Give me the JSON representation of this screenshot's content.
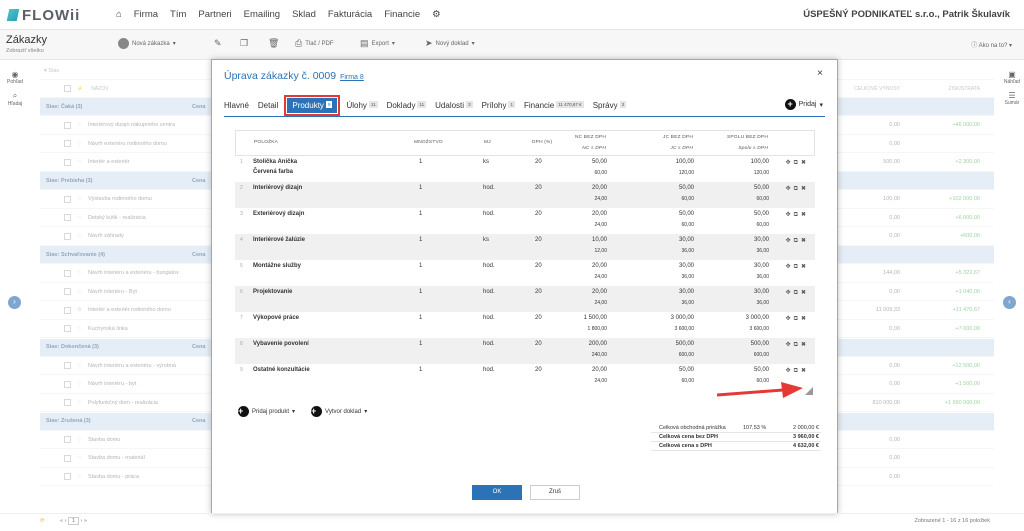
{
  "app": {
    "logo": "FLOWii",
    "menu": [
      "Firma",
      "Tím",
      "Partneri",
      "Emailing",
      "Sklad",
      "Fakturácia",
      "Financie"
    ],
    "company": "ÚSPEŠNÝ PODNIKATEĽ s.r.o., Patrik Škulavík"
  },
  "page": {
    "title": "Zákazky",
    "subtitle": "Zobraziť všetko",
    "toolbar": {
      "new": "Nová zákazka",
      "print": "Tlač / PDF",
      "export": "Export",
      "newdoc": "Nový doklad"
    },
    "help": "Ako na to?",
    "left_side": [
      "Pohľad",
      "Hľadaj"
    ],
    "right_side": [
      "Náhľad",
      "Sumár"
    ],
    "filter": "Stav",
    "col_name": "NÁZOV",
    "col_a": "CELKOVÉ VÝNOSY",
    "col_b": "ZISK/STRATA",
    "footer_left": "1",
    "footer_right": "Zobrazené 1 - 16 z 16 položiek"
  },
  "bg_rows": [
    {
      "g": "Stav: Čaká (3)",
      "c": "Cena"
    },
    {
      "n": "Interiérový dizajn nákupného centra",
      "v1": "0,00",
      "v2": "+46 000,00"
    },
    {
      "n": "Návrh exteriéru rodinného domu",
      "v1": "0,00",
      "v2": ""
    },
    {
      "n": "Interiér a exteriér",
      "v1": "500,00",
      "v2": "+2 300,00"
    },
    {
      "g": "Stav: Prebieha (3)",
      "c": "Cena"
    },
    {
      "n": "Výstavba rodinného domu",
      "v1": "100,00",
      "v2": "+102 000,00"
    },
    {
      "n": "Detský kútik - realizácia",
      "v1": "0,00",
      "v2": "+6 000,00"
    },
    {
      "n": "Návrh záhrady",
      "v1": "0,00",
      "v2": "+600,00"
    },
    {
      "g": "Stav: Schvaľovanie (4)",
      "c": "Cena"
    },
    {
      "n": "Návrh interiéru a exteriéru - bungalov",
      "v1": "144,00",
      "v2": "+5 322,67"
    },
    {
      "n": "Návrh interiéru - Byt",
      "v1": "0,00",
      "v2": "+1 040,00"
    },
    {
      "n": "Interiér a exteriér rodinného domu",
      "v1": "11 009,33",
      "v2": "+11 470,67"
    },
    {
      "n": "Kuchynská linka",
      "v1": "0,00",
      "v2": "+7 000,00"
    },
    {
      "g": "Stav: Dokončená (3)",
      "c": "Cena"
    },
    {
      "n": "Návrh interiéru a exteriéru - výrobná",
      "v1": "0,00",
      "v2": "+12 500,00"
    },
    {
      "n": "Návrh interiéru - byt",
      "v1": "0,00",
      "v2": "+1 500,00"
    },
    {
      "n": "Polyfunkčný dom - realizácia",
      "v1": "810 000,00",
      "v2": "+1 990 000,00"
    },
    {
      "g": "Stav: Zrušená (3)",
      "c": "Cena"
    },
    {
      "n": "Stavba domu",
      "v1": "0,00",
      "v2": ""
    },
    {
      "n": "Stavba domu - materiál",
      "v1": "0,00",
      "v2": ""
    },
    {
      "n": "Stavba domu - práca",
      "v1": "0,00",
      "v2": ""
    }
  ],
  "modal": {
    "title": "Úprava zákazky č. 0009",
    "firm": "Firma 8",
    "close": "×",
    "tabs": [
      {
        "label": "Hlavné"
      },
      {
        "label": "Detail"
      },
      {
        "label": "Produkty",
        "badge": "9",
        "active": true
      },
      {
        "label": "Úlohy",
        "badge": "11"
      },
      {
        "label": "Doklady",
        "badge": "11"
      },
      {
        "label": "Udalosti",
        "badge": "3"
      },
      {
        "label": "Prílohy",
        "badge": "1"
      },
      {
        "label": "Financie",
        "badge": "11 470,67 €"
      },
      {
        "label": "Správy",
        "badge": "3"
      }
    ],
    "add": "Pridaj",
    "headers": {
      "item": "POLOŽKA",
      "qty": "MNOŽSTVO",
      "unit": "MJ",
      "vat": "DPH (%)",
      "nc": "NC BEZ DPH",
      "nc2": "NC s DPH",
      "jc": "JC BEZ DPH",
      "jc2": "JC s DPH",
      "total": "SPOLU BEZ DPH",
      "total2": "Spolu s DPH"
    },
    "items": [
      {
        "n": "1",
        "name": "Stolička Anička",
        "name2": "Červená farba",
        "qty": "1",
        "unit": "ks",
        "vat": "20",
        "a1": "50,00",
        "a2": "60,00",
        "b1": "100,00",
        "b2": "120,00",
        "c1": "100,00",
        "c2": "120,00"
      },
      {
        "n": "2",
        "name": "Interiérový dizajn",
        "qty": "1",
        "unit": "hod.",
        "vat": "20",
        "a1": "20,00",
        "a2": "24,00",
        "b1": "50,00",
        "b2": "60,00",
        "c1": "50,00",
        "c2": "60,00"
      },
      {
        "n": "3",
        "name": "Exteriérový dizajn",
        "qty": "1",
        "unit": "hod.",
        "vat": "20",
        "a1": "20,00",
        "a2": "24,00",
        "b1": "50,00",
        "b2": "60,00",
        "c1": "50,00",
        "c2": "60,00"
      },
      {
        "n": "4",
        "name": "Interiérové žalúzie",
        "qty": "1",
        "unit": "ks",
        "vat": "20",
        "a1": "10,00",
        "a2": "12,00",
        "b1": "30,00",
        "b2": "36,00",
        "c1": "30,00",
        "c2": "36,00"
      },
      {
        "n": "5",
        "name": "Montážne služby",
        "qty": "1",
        "unit": "hod.",
        "vat": "20",
        "a1": "20,00",
        "a2": "24,00",
        "b1": "30,00",
        "b2": "36,00",
        "c1": "30,00",
        "c2": "36,00"
      },
      {
        "n": "6",
        "name": "Projektovanie",
        "qty": "1",
        "unit": "hod.",
        "vat": "20",
        "a1": "20,00",
        "a2": "24,00",
        "b1": "30,00",
        "b2": "36,00",
        "c1": "30,00",
        "c2": "36,00"
      },
      {
        "n": "7",
        "name": "Výkopové práce",
        "qty": "1",
        "unit": "hod.",
        "vat": "20",
        "a1": "1 500,00",
        "a2": "1 800,00",
        "b1": "3 000,00",
        "b2": "3 600,00",
        "c1": "3 000,00",
        "c2": "3 600,00"
      },
      {
        "n": "8",
        "name": "Vybavenie povolení",
        "qty": "1",
        "unit": "hod.",
        "vat": "20",
        "a1": "200,00",
        "a2": "240,00",
        "b1": "500,00",
        "b2": "600,00",
        "c1": "500,00",
        "c2": "600,00"
      },
      {
        "n": "9",
        "name": "Ostatné konzultácie",
        "qty": "1",
        "unit": "hod.",
        "vat": "20",
        "a1": "20,00",
        "a2": "24,00",
        "b1": "50,00",
        "b2": "60,00",
        "c1": "50,00",
        "c2": "60,00"
      }
    ],
    "add_product": "Pridaj produkt",
    "create_doc": "Vytvor doklad",
    "summary": [
      {
        "k": "Celková obchodná prirážka",
        "p": "107,53 %",
        "v": "2 000,00 €"
      },
      {
        "k": "Celková cena bez DPH",
        "p": "",
        "v": "3 960,00 €"
      },
      {
        "k": "Celková cena s DPH",
        "p": "",
        "v": "4 632,00 €"
      }
    ],
    "ok": "OK",
    "cancel": "Zruš"
  },
  "colors": {
    "accent": "#2b73b6",
    "highlight": "#e53935"
  }
}
